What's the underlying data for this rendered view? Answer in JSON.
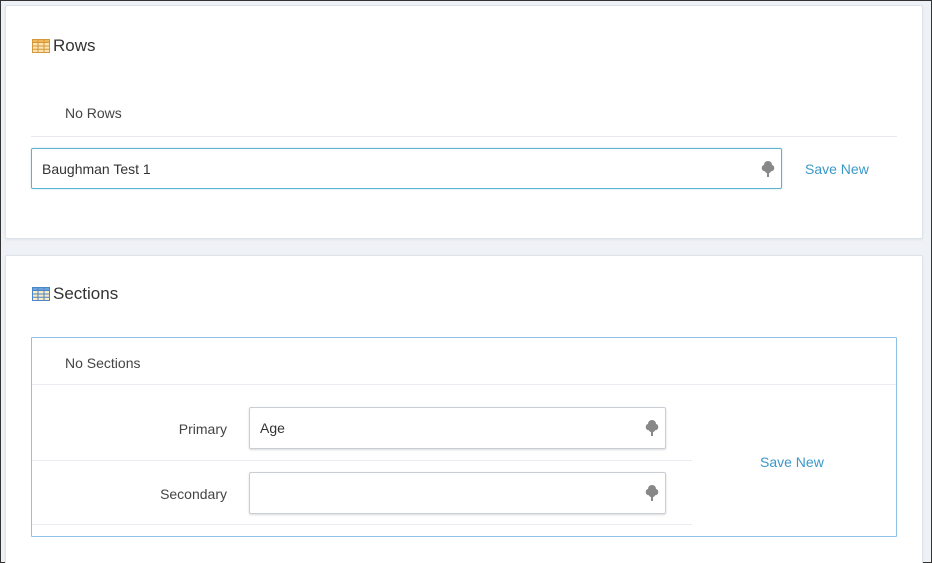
{
  "rows_panel": {
    "title": "Rows",
    "empty_message": "No Rows",
    "input_value": "Baughman Test 1",
    "save_label": "Save New"
  },
  "sections_panel": {
    "title": "Sections",
    "empty_message": "No Sections",
    "primary_label": "Primary",
    "primary_value": "Age",
    "secondary_label": "Secondary",
    "secondary_value": "",
    "save_label": "Save New"
  },
  "icons": {
    "panel_icon": "table-icon",
    "input_icon": "tree-icon"
  },
  "colors": {
    "link": "#3a98c9",
    "focus_border": "#5bb3cf",
    "section_box_border": "#8fc0e6"
  }
}
